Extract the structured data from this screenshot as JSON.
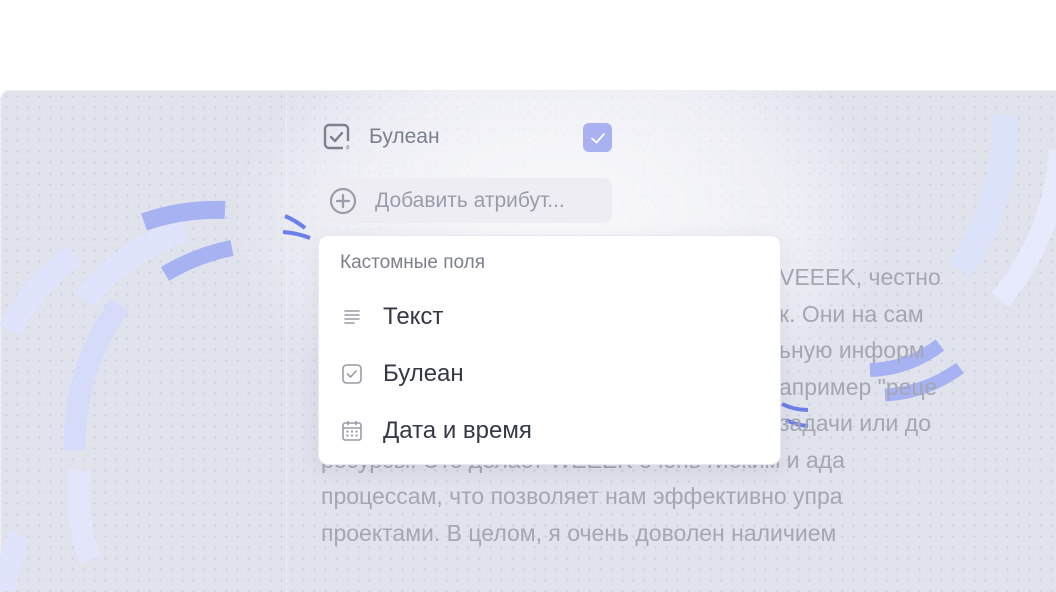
{
  "attributes": {
    "boolean_label": "Булеан",
    "boolean_checked": true,
    "add_attribute_label": "Добавить атрибут..."
  },
  "dropdown": {
    "header": "Кастомные поля",
    "items": [
      {
        "label": "Текст",
        "icon": "text-lines-icon"
      },
      {
        "label": "Булеан",
        "icon": "checkbox-icon"
      },
      {
        "label": "Дата и время",
        "icon": "calendar-icon"
      }
    ]
  },
  "background_text": {
    "lines_right": [
      "VEEEK, честно",
      "к. Они на сам",
      "ьную информ",
      "апример \"реце",
      "задачи или до"
    ],
    "lines_full": [
      "ресурсы. Это делает WEEEK очень гибким и ада",
      "процессам, что позволяет нам эффективно упра",
      "проектами. В целом, я очень доволен наличием"
    ]
  },
  "colors": {
    "accent": "#a9b1f1",
    "arc_strong": "#7b8cf0",
    "arc_light": "#dfe3fb",
    "text_primary": "#353846",
    "text_muted": "#7d808c"
  }
}
